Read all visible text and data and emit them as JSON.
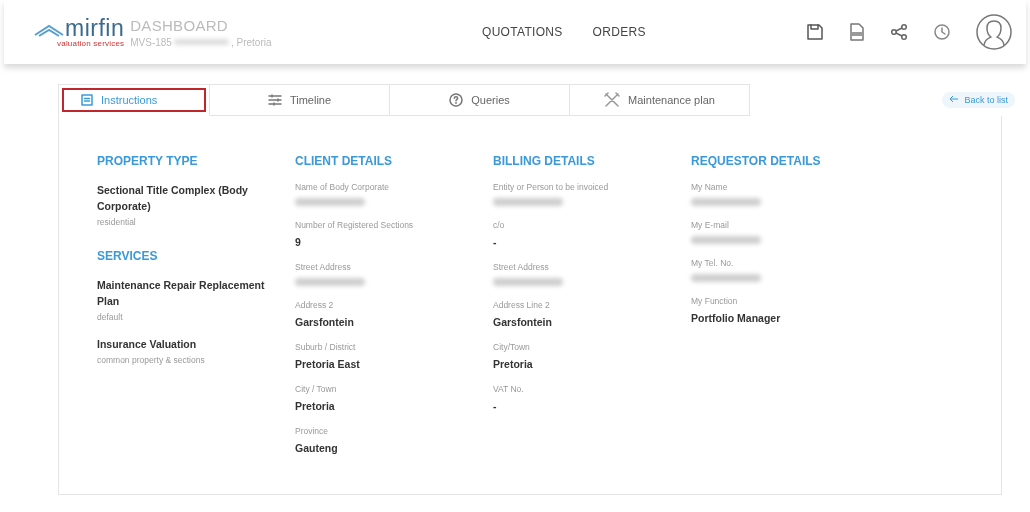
{
  "header": {
    "logo": {
      "word": "mirfin",
      "tagline": "valuation services"
    },
    "title": "DASHBOARD",
    "subtitle_start": "MVS-185",
    "subtitle_redacted": true,
    "subtitle_end": ", Pretoria",
    "nav": [
      {
        "label": "QUOTATIONS"
      },
      {
        "label": "ORDERS"
      }
    ],
    "actions": [
      {
        "kind": "save"
      },
      {
        "kind": "pdf"
      },
      {
        "kind": "share"
      },
      {
        "kind": "history"
      },
      {
        "kind": "profile"
      }
    ]
  },
  "tabs": [
    {
      "label": "Instructions",
      "selected": true,
      "highlighted": true
    },
    {
      "label": "Timeline",
      "selected": false,
      "highlighted": false
    },
    {
      "label": "Queries",
      "selected": false,
      "highlighted": false
    },
    {
      "label": "Maintenance plan",
      "selected": false,
      "highlighted": false
    }
  ],
  "back_button": {
    "label": "Back to list"
  },
  "columns": [
    {
      "sections": [
        {
          "heading": "PROPERTY TYPE",
          "items": [
            {
              "kind": "service",
              "title": "Sectional Title Complex (Body Corporate)",
              "note": "residential"
            }
          ]
        },
        {
          "heading": "SERVICES",
          "items": [
            {
              "kind": "service",
              "title": "Maintenance Repair Replacement Plan",
              "note": "default"
            },
            {
              "kind": "service",
              "title": "Insurance Valuation",
              "note": "common property & sections"
            }
          ]
        }
      ]
    },
    {
      "sections": [
        {
          "heading": "CLIENT DETAILS",
          "items": [
            {
              "kind": "field",
              "label": "Name of Body Corporate",
              "redacted": true
            },
            {
              "kind": "field",
              "label": "Number of Registered Sections",
              "value": "9"
            },
            {
              "kind": "field",
              "label": "Street Address",
              "redacted": true
            },
            {
              "kind": "field",
              "label": "Address 2",
              "value": "Garsfontein"
            },
            {
              "kind": "field",
              "label": "Suburb / District",
              "value": "Pretoria East"
            },
            {
              "kind": "field",
              "label": "City / Town",
              "value": "Pretoria"
            },
            {
              "kind": "field",
              "label": "Province",
              "value": "Gauteng"
            }
          ]
        }
      ]
    },
    {
      "sections": [
        {
          "heading": "BILLING DETAILS",
          "items": [
            {
              "kind": "field",
              "label": "Entity or Person to be invoiced",
              "redacted": true
            },
            {
              "kind": "field",
              "label": "c/o",
              "value": "-"
            },
            {
              "kind": "field",
              "label": "Street Address",
              "redacted": true
            },
            {
              "kind": "field",
              "label": "Address Line 2",
              "value": "Garsfontein"
            },
            {
              "kind": "field",
              "label": "City/Town",
              "value": "Pretoria"
            },
            {
              "kind": "field",
              "label": "VAT No.",
              "value": "-"
            }
          ]
        }
      ]
    },
    {
      "sections": [
        {
          "heading": "REQUESTOR DETAILS",
          "items": [
            {
              "kind": "field",
              "label": "My Name",
              "redacted": true
            },
            {
              "kind": "field",
              "label": "My E-mail",
              "redacted": true
            },
            {
              "kind": "field",
              "label": "My Tel. No.",
              "redacted": true
            },
            {
              "kind": "field",
              "label": "My Function",
              "value": "Portfolio Manager"
            }
          ]
        }
      ]
    }
  ]
}
